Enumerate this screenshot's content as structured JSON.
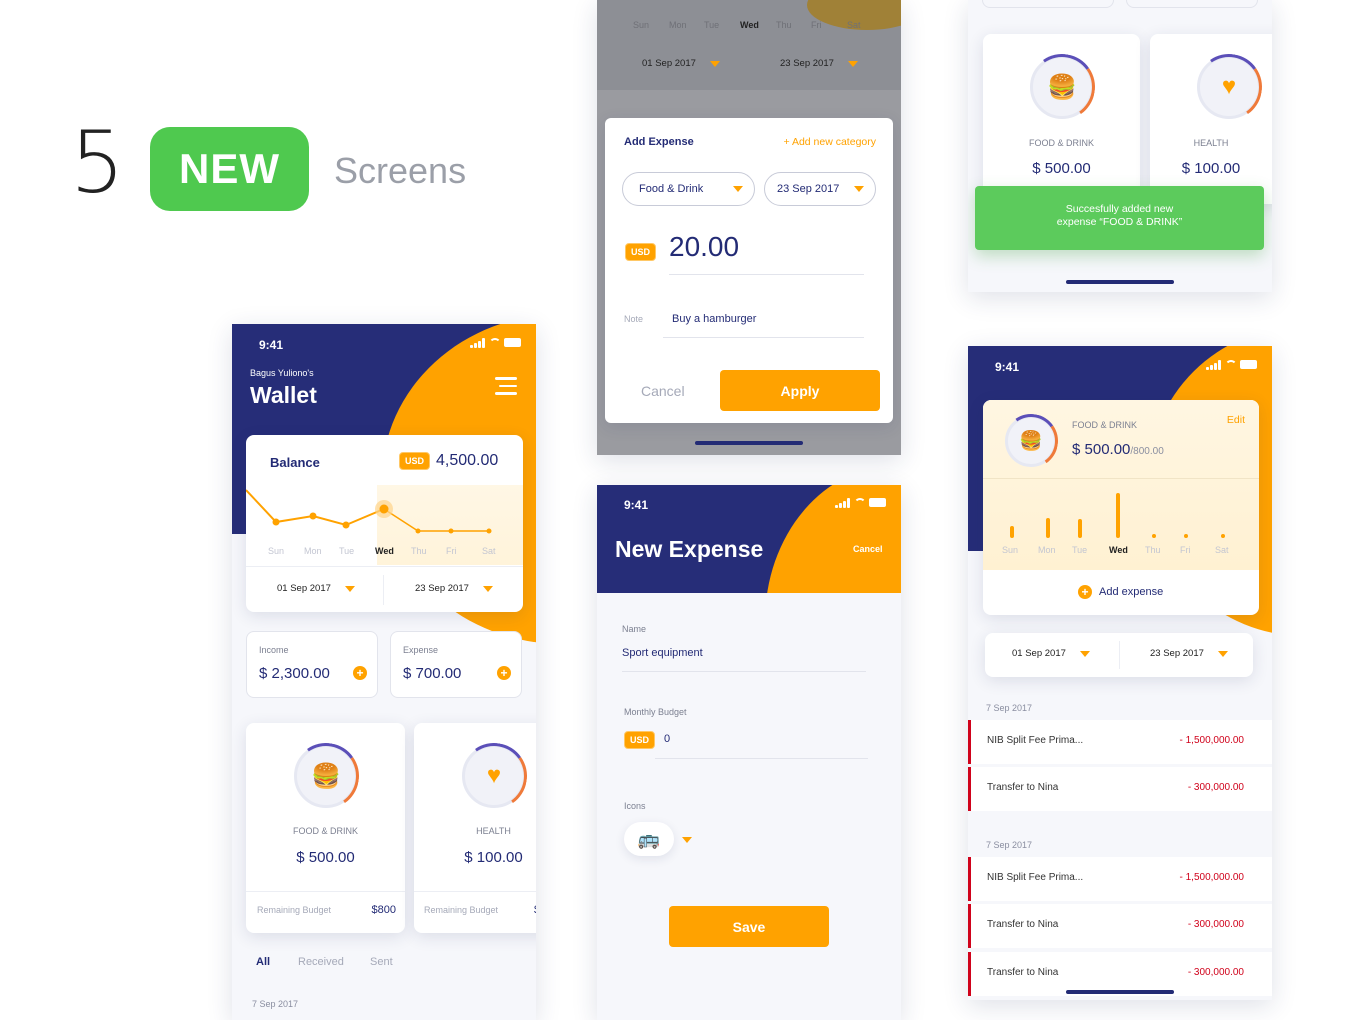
{
  "hero": {
    "number": "5",
    "badge": "NEW",
    "text": "Screens"
  },
  "colors": {
    "navy": "#262d78",
    "orange": "#ffa200",
    "green": "#4fc94f",
    "red": "#d0021b"
  },
  "status": {
    "time": "9:41"
  },
  "wallet": {
    "owner": "Bagus Yuliono's",
    "title": "Wallet",
    "balance_label": "Balance",
    "currency": "USD",
    "balance": "4,500.00",
    "days": [
      "Sun",
      "Mon",
      "Tue",
      "Wed",
      "Thu",
      "Fri",
      "Sat"
    ],
    "date_from": "01 Sep 2017",
    "date_to": "23 Sep 2017",
    "income_label": "Income",
    "income": "$ 2,300.00",
    "expense_label": "Expense",
    "expense": "$ 700.00",
    "categories": [
      {
        "name": "FOOD & DRINK",
        "amount": "$ 500.00",
        "remaining_label": "Remaining Budget",
        "remaining": "$800",
        "icon": "food-icon"
      },
      {
        "name": "HEALTH",
        "amount": "$ 100.00",
        "remaining_label": "Remaining Budget",
        "remaining": "$",
        "icon": "heart-icon"
      }
    ],
    "tabs": [
      "All",
      "Received",
      "Sent"
    ],
    "section_date": "7 Sep 2017"
  },
  "add_expense": {
    "days": [
      "Sun",
      "Mon",
      "Tue",
      "Wed",
      "Thu",
      "Fri",
      "Sat"
    ],
    "date_from": "01 Sep 2017",
    "date_to": "23 Sep 2017",
    "title": "Add Expense",
    "add_category": "+ Add new category",
    "category": "Food & Drink",
    "date": "23 Sep 2017",
    "currency": "USD",
    "amount": "20.00",
    "note_label": "Note",
    "note": "Buy a hamburger",
    "cancel": "Cancel",
    "apply": "Apply"
  },
  "success": {
    "categories": [
      {
        "name": "FOOD & DRINK",
        "amount": "$ 500.00"
      },
      {
        "name": "HEALTH",
        "amount": "$ 100.00"
      }
    ],
    "toast": "Succesfully added new expense “FOOD & DRINK”",
    "toast_line1": "Succesfully added new",
    "toast_line2": "expense “FOOD & DRINK”"
  },
  "new_expense": {
    "title": "New Expense",
    "cancel": "Cancel",
    "name_label": "Name",
    "name_value": "Sport equipment",
    "budget_label": "Monthly Budget",
    "currency": "USD",
    "budget_value": "0",
    "icons_label": "Icons",
    "save": "Save"
  },
  "detail": {
    "category": "FOOD & DRINK",
    "amount": "$ 500.00",
    "budget": "/800.00",
    "edit": "Edit",
    "days": [
      "Sun",
      "Mon",
      "Tue",
      "Wed",
      "Thu",
      "Fri",
      "Sat"
    ],
    "add_expense": "Add expense",
    "date_from": "01 Sep 2017",
    "date_to": "23 Sep 2017",
    "groups": [
      {
        "date": "7 Sep 2017",
        "rows": [
          {
            "name": "NIB Split Fee Prima...",
            "amount": "- 1,500,000.00"
          },
          {
            "name": "Transfer to Nina",
            "amount": "- 300,000.00"
          }
        ]
      },
      {
        "date": "7 Sep 2017",
        "rows": [
          {
            "name": "NIB Split Fee Prima...",
            "amount": "- 1,500,000.00"
          },
          {
            "name": "Transfer to Nina",
            "amount": "- 300,000.00"
          },
          {
            "name": "Transfer to Nina",
            "amount": "- 300,000.00"
          }
        ]
      }
    ]
  }
}
